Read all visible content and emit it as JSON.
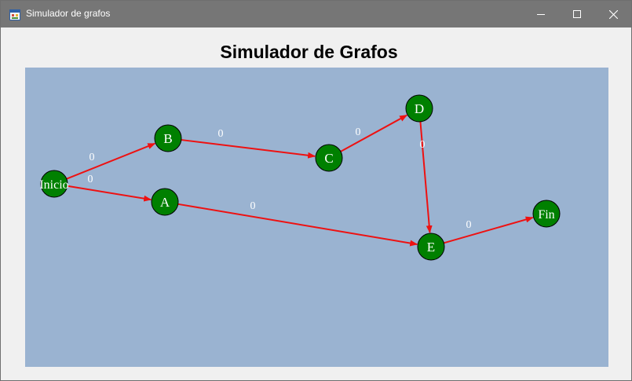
{
  "window": {
    "title": "Simulador de grafos",
    "controls": {
      "minimize": "minimize-icon",
      "maximize": "maximize-icon",
      "close": "close-icon"
    }
  },
  "heading": "Simulador de Grafos",
  "graph": {
    "node_color": "#008000",
    "edge_color": "#ee1111",
    "background": "#9ab3d1",
    "nodes": [
      {
        "id": "Inicio",
        "label": "Inicio"
      },
      {
        "id": "B",
        "label": "B"
      },
      {
        "id": "A",
        "label": "A"
      },
      {
        "id": "C",
        "label": "C"
      },
      {
        "id": "D",
        "label": "D"
      },
      {
        "id": "E",
        "label": "E"
      },
      {
        "id": "Fin",
        "label": "Fin"
      }
    ],
    "edges": [
      {
        "from": "Inicio",
        "to": "B",
        "weight": "0"
      },
      {
        "from": "Inicio",
        "to": "A",
        "weight": "0"
      },
      {
        "from": "B",
        "to": "C",
        "weight": "0"
      },
      {
        "from": "C",
        "to": "D",
        "weight": "0"
      },
      {
        "from": "D",
        "to": "E",
        "weight": "0"
      },
      {
        "from": "A",
        "to": "E",
        "weight": "0"
      },
      {
        "from": "E",
        "to": "Fin",
        "weight": "0"
      }
    ]
  }
}
